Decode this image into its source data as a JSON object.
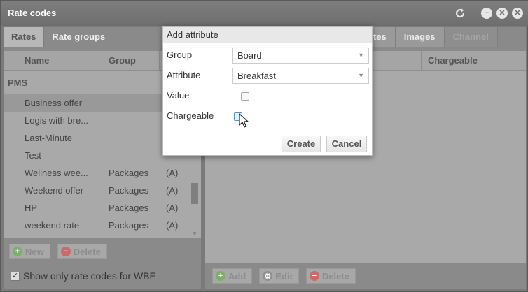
{
  "window": {
    "title": "Rate codes",
    "controls": [
      "refresh-icon",
      "minimize-icon",
      "restore-icon",
      "close-icon"
    ]
  },
  "left": {
    "tabs": [
      "Rates",
      "Rate groups"
    ],
    "columns": [
      "Name",
      "Group"
    ],
    "group_label": "PMS",
    "rows": [
      {
        "name": "Business offer",
        "group": "",
        "flag": ""
      },
      {
        "name": "Logis with bre...",
        "group": "",
        "flag": ""
      },
      {
        "name": "Last-Minute",
        "group": "",
        "flag": ""
      },
      {
        "name": "Test",
        "group": "",
        "flag": ""
      },
      {
        "name": "Wellness wee...",
        "group": "Packages",
        "flag": "(A)"
      },
      {
        "name": "Weekend offer",
        "group": "Packages",
        "flag": "(A)"
      },
      {
        "name": "HP",
        "group": "Packages",
        "flag": "(A)"
      },
      {
        "name": "weekend rate",
        "group": "Packages",
        "flag": "(A)"
      }
    ],
    "toolbar": {
      "new": "New",
      "delete": "Delete"
    },
    "wbe_label": "Show only rate codes for WBE",
    "wbe_checked": true
  },
  "right": {
    "tabs": [
      "utes",
      "Images",
      "Channel"
    ],
    "columns": [
      "Chargeable"
    ],
    "toolbar": {
      "add": "Add",
      "edit": "Edit",
      "delete": "Delete"
    }
  },
  "modal": {
    "title": "Add attribute",
    "group_label": "Group",
    "group_value": "Board",
    "attribute_label": "Attribute",
    "attribute_value": "Breakfast",
    "value_label": "Value",
    "chargeable_label": "Chargeable",
    "create_label": "Create",
    "cancel_label": "Cancel"
  }
}
